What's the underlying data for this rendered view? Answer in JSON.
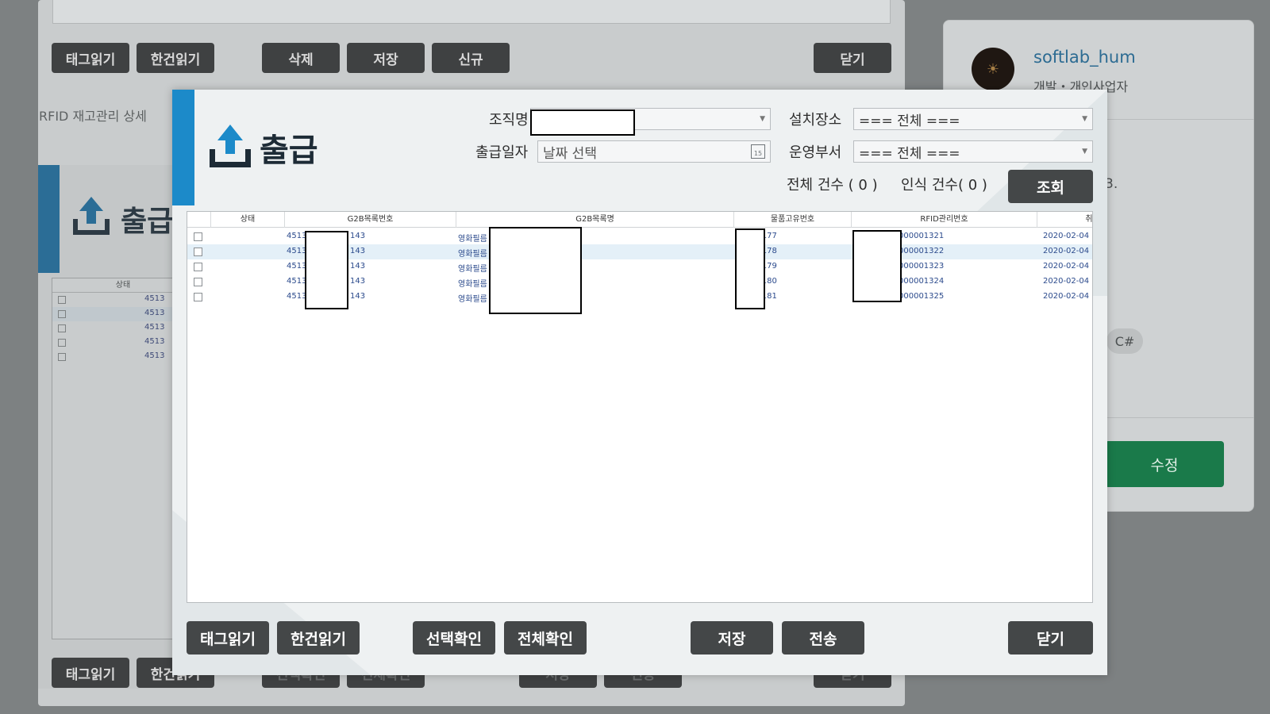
{
  "background": {
    "top_buttons": [
      "태그읽기",
      "한건읽기",
      "삭제",
      "저장",
      "신규",
      "닫기"
    ],
    "breadcrumb": "RFID 재고관리 상세",
    "title": "출급",
    "table_header": "상태",
    "rows": [
      "4513",
      "4513",
      "4513",
      "4513",
      "4513"
    ],
    "bottom_buttons": [
      "태그읽기",
      "한건읽기",
      "선택확인",
      "전체확인",
      "저장",
      "전송",
      "닫기"
    ]
  },
  "profile": {
    "name": "softlab_hum",
    "role": "개발・개인사업자",
    "fragment": "3.",
    "tag": "C#",
    "edit_label": "수정"
  },
  "dialog": {
    "title": "출급",
    "org_label": "조직명",
    "location_label": "설치장소",
    "location_value": "=== 전체 ===",
    "date_label": "출급일자",
    "date_placeholder": "날짜 선택",
    "calendar_day": "15",
    "dept_label": "운영부서",
    "dept_value": "=== 전체 ===",
    "total_count_text": "전체 건수 ( 0 )",
    "recognized_count_text": "인식 건수( 0 )",
    "search_label": "조회",
    "columns": [
      "상태",
      "G2B목록번호",
      "G2B목록명",
      "물품고유번호",
      "RFID관리번호",
      "취득일"
    ],
    "rows": [
      {
        "g2b_no_a": "4513",
        "g2b_no_b": "143",
        "g2b_name": "영화필름",
        "item_no": "02177",
        "rfid": "000001321",
        "date": "2020-02-04"
      },
      {
        "g2b_no_a": "4513",
        "g2b_no_b": "143",
        "g2b_name": "영화필름",
        "item_no": "02178",
        "rfid": "000001322",
        "date": "2020-02-04"
      },
      {
        "g2b_no_a": "4513",
        "g2b_no_b": "143",
        "g2b_name": "영화필름",
        "item_no": "02179",
        "rfid": "000001323",
        "date": "2020-02-04"
      },
      {
        "g2b_no_a": "4513",
        "g2b_no_b": "143",
        "g2b_name": "영화필름",
        "item_no": "02180",
        "rfid": "000001324",
        "date": "2020-02-04"
      },
      {
        "g2b_no_a": "4513",
        "g2b_no_b": "143",
        "g2b_name": "영화필름",
        "item_no": "02181",
        "rfid": "000001325",
        "date": "2020-02-04"
      }
    ],
    "buttons": {
      "tag_read": "태그읽기",
      "single_read": "한건읽기",
      "select_confirm": "선택확인",
      "all_confirm": "전체확인",
      "save": "저장",
      "send": "전송",
      "close": "닫기"
    }
  }
}
